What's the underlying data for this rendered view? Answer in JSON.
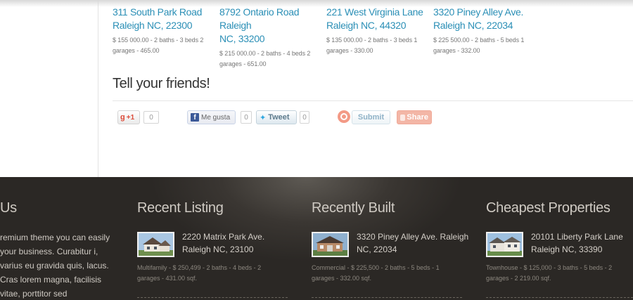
{
  "listings": [
    {
      "title_line1": "311 South Park Road",
      "title_line2": "Raleigh NC, 22300",
      "meta_line1": "$ 155 000.00 - 2 baths - 3 beds 2",
      "meta_line2": "garages - 465.00"
    },
    {
      "title_line1": "8792 Ontario Road Raleigh",
      "title_line2": "NC, 33200",
      "meta_line1": "$ 215 000.00 - 2 baths - 4 beds 2",
      "meta_line2": "garages - 651.00"
    },
    {
      "title_line1": "221 West Virginia Lane",
      "title_line2": "Raleigh NC, 44320",
      "meta_line1": "$ 135 000.00 - 2 baths - 3 beds 1",
      "meta_line2": "garages - 330.00"
    },
    {
      "title_line1": "3320 Piney Alley Ave.",
      "title_line2": "Raleigh NC, 22034",
      "meta_line1": "$ 225 500.00 - 2 baths - 5 beds 1",
      "meta_line2": "garages - 332.00"
    }
  ],
  "share": {
    "title": "Tell your friends!",
    "gplus_label": "+1",
    "gplus_count": "0",
    "fb_label": "Me gusta",
    "fb_count": "0",
    "tweet_label": "Tweet",
    "tweet_count": "0",
    "submit_label": "Submit",
    "share_label": "Share"
  },
  "footer": {
    "about": {
      "heading": "Us",
      "text": "remium theme you can easily your business. Curabitur i, varius eu gravida quis, lacus. Cras lorem magna, facilisis vitae, porttitor sed"
    },
    "columns": [
      {
        "heading": "Recent Listing",
        "title": "2220 Matrix Park Ave. Raleigh NC, 23100",
        "meta_line1": "Multifamily - $ 250,499 - 2 baths - 4 beds - 2",
        "meta_line2": "garages - 431.00 sqf."
      },
      {
        "heading": "Recently Built",
        "title": "3320 Piney Alley Ave. Raleigh NC, 22034",
        "meta_line1": "Commercial - $ 225,500 - 2 baths - 5 beds - 1",
        "meta_line2": "garages - 332.00 sqf."
      },
      {
        "heading": "Cheapest Properties",
        "title": "20101 Liberty Park Lane Raleigh NC, 33390",
        "meta_line1": "Townhouse - $ 125,000 - 3 baths - 5 beds - 2",
        "meta_line2": "garages - 2 219.00 sqf."
      }
    ]
  }
}
